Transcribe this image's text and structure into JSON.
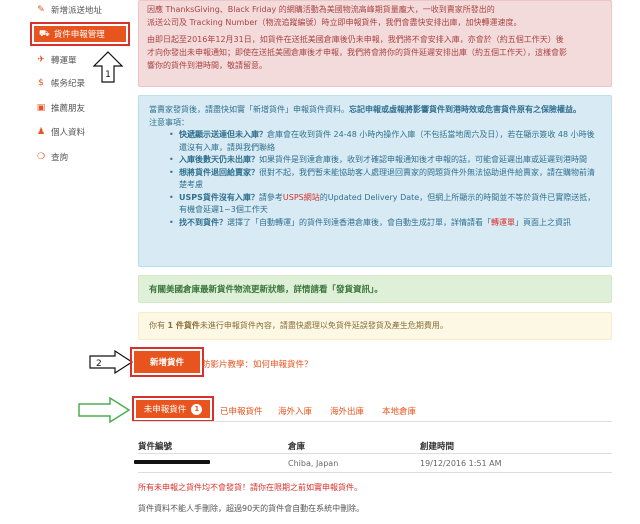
{
  "sidebar": {
    "items": [
      {
        "label": "新增派送地址",
        "icon": "address-icon"
      },
      {
        "label": "貨件申報管理",
        "icon": "truck-icon",
        "active": true
      },
      {
        "label": "轉運單",
        "icon": "plane-icon"
      },
      {
        "label": "帳务纪录",
        "icon": "dollar-icon"
      },
      {
        "label": "推薦朋友",
        "icon": "gift-icon"
      },
      {
        "label": "個人資料",
        "icon": "user-icon"
      },
      {
        "label": "查詢",
        "icon": "lifebuoy-icon"
      }
    ],
    "callout_number": "1"
  },
  "alerts": {
    "red": {
      "lines": [
        "因應 ThanksGiving、Black Friday 的網購活動為美國物流高峰期貨量龐大，一收到賣家所發出的",
        "派送公司及 Tracking Number（物流追蹤編號）時立即申報貨件，我們會盡快安排出庫，加快轉運速度。",
        "由即日起至2016年12月31日，如貨件在送抵美國倉庫後仍未申報，我們將不會安排入庫，亦會於（約五個工作天）後",
        "才向你發出未申報通知；即使在送抵美國倉庫後才申報，我們將會將你的貨件延遲安排出庫（約五個工作天），這樣會影",
        "響你的貨件到港時間，敬請留意。"
      ]
    },
    "blue": {
      "intro": "當賣家發貨後，請盡快如實「新增貨件」申報貨件資料。",
      "intro_bold": "忘記申報或虛報將影響貨件到港時效或危害貨件原有之保險權益。",
      "notes_title": "注意事項：",
      "items": [
        {
          "bold": "快遞顯示送達但未入庫？",
          "text": "倉庫會在收到貨件 24-48 小時內操作入庫（不包括當地周六及日），若在顯示簽收 48 小時後還沒有入庫，請與我們聯絡"
        },
        {
          "bold": "入庫後數天仍未出庫？",
          "text": "如果貨件是到達倉庫後，收到才確認申報通知後才申報的話，可能會延遲出庫或延遲到港時間"
        },
        {
          "bold": "想將貨件退回給賣家？",
          "text": "很對不起，我們暫未能協助客人處理退回賣家的問題貨件外無法協助退件給賣家，請在購物前清楚考慮"
        },
        {
          "bold": "USPS貨件沒有入庫？",
          "text": "請參考",
          "link": "USPS網站",
          "text2": "的Updated Delivery Date，但網上所顯示的時間並不等於貨件已實際送抵，有機會延遲1~3個工作天"
        },
        {
          "bold": "找不到貨件？",
          "text": "選擇了「自動轉運」的貨件到達香港倉庫後，會自動生成訂單，詳情請看「",
          "link": "轉運單",
          "text2": "」頁面上之資訊"
        }
      ]
    },
    "green": "有關美國倉庫最新貨件物流更新狀態，詳情請看「發貨資訊」。",
    "yellow": {
      "prefix": "你有 ",
      "bold": "1 件貨件",
      "suffix": "未進行申報貨件內容，請盡快處理以免貨件延誤發貨及產生危期費用。"
    }
  },
  "actions": {
    "add_button": "新增貨件",
    "video_link": "防影片教學：如何申報貨件？",
    "callout_number": "2"
  },
  "tabs": [
    {
      "label": "未申報貨件",
      "count": "1",
      "active": true
    },
    {
      "label": "已申報貨件"
    },
    {
      "label": "海外入庫"
    },
    {
      "label": "海外出庫"
    },
    {
      "label": "本地倉庫"
    }
  ],
  "table": {
    "headers": [
      "貨件編號",
      "倉庫",
      "創建時間"
    ],
    "rows": [
      {
        "id": "",
        "warehouse": "Chiba, Japan",
        "created": "19/12/2016 1:51 AM"
      }
    ]
  },
  "notes": {
    "red": "所有未申報之貨件均不會發貨！請你在限期之前如實申報貨件。",
    "gray": "貨件資料不能人手刪除，超過90天的貨件會自動在系統中刪除。"
  },
  "colors": {
    "accent": "#e8541d",
    "highlight_border": "#d9302b",
    "callout_arrow": "#ffffff",
    "green_arrow": "#4caf50"
  }
}
